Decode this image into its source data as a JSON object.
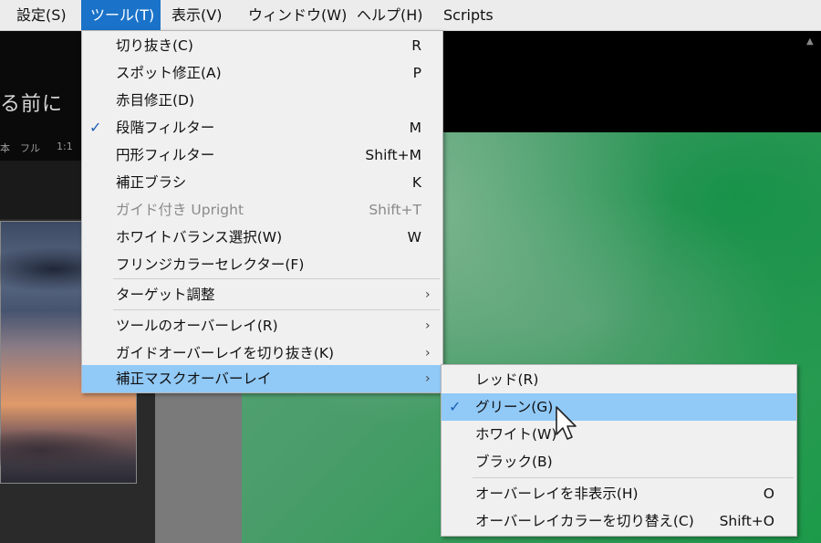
{
  "menubar": {
    "items": [
      {
        "label": "設定(S)",
        "active": false
      },
      {
        "label": "ツール(T)",
        "active": true
      },
      {
        "label": "表示(V)",
        "active": false
      },
      {
        "label": "ウィンドウ(W)",
        "active": false
      },
      {
        "label": "ヘルプ(H)",
        "active": false
      },
      {
        "label": "Scripts",
        "active": false
      }
    ]
  },
  "app": {
    "title_fragment": "る前に",
    "view_modes": [
      "本",
      "フル",
      "1:1"
    ]
  },
  "tools_menu": {
    "items": [
      {
        "label": "切り抜き(C)",
        "shortcut": "R"
      },
      {
        "label": "スポット修正(A)",
        "shortcut": "P"
      },
      {
        "label": "赤目修正(D)",
        "shortcut": ""
      },
      {
        "label": "段階フィルター",
        "shortcut": "M",
        "checked": true
      },
      {
        "label": "円形フィルター",
        "shortcut": "Shift+M"
      },
      {
        "label": "補正ブラシ",
        "shortcut": "K"
      },
      {
        "label": "ガイド付き Upright",
        "shortcut": "Shift+T",
        "disabled": true
      },
      {
        "label": "ホワイトバランス選択(W)",
        "shortcut": "W"
      },
      {
        "label": "フリンジカラーセレクター(F)",
        "shortcut": ""
      },
      {
        "label": "ターゲット調整",
        "submenu": true
      },
      {
        "label": "ツールのオーバーレイ(R)",
        "submenu": true
      },
      {
        "label": "ガイドオーバーレイを切り抜き(K)",
        "submenu": true
      },
      {
        "label": "補正マスクオーバーレイ",
        "submenu": true,
        "highlighted": true
      }
    ]
  },
  "overlay_submenu": {
    "items": [
      {
        "label": "レッド(R)",
        "shortcut": ""
      },
      {
        "label": "グリーン(G)",
        "shortcut": "",
        "checked": true,
        "highlighted": true
      },
      {
        "label": "ホワイト(W)",
        "shortcut": ""
      },
      {
        "label": "ブラック(B)",
        "shortcut": ""
      },
      {
        "label": "オーバーレイを非表示(H)",
        "shortcut": "O"
      },
      {
        "label": "オーバーレイカラーを切り替え(C)",
        "shortcut": "Shift+O"
      }
    ]
  },
  "colors": {
    "menubar_bg": "#ececec",
    "menubar_active": "#1a73c9",
    "menu_bg": "#f0f0f0",
    "highlight": "#91c9f7",
    "check": "#1a5fb4",
    "image_green": "#2f9a55"
  },
  "icons": {
    "check": "checkmark-icon",
    "submenu": "chevron-right-icon",
    "pointer": "mouse-pointer-icon"
  },
  "glyphs": {
    "check": "✓",
    "chevron": "›",
    "scroll_up": "▲"
  }
}
